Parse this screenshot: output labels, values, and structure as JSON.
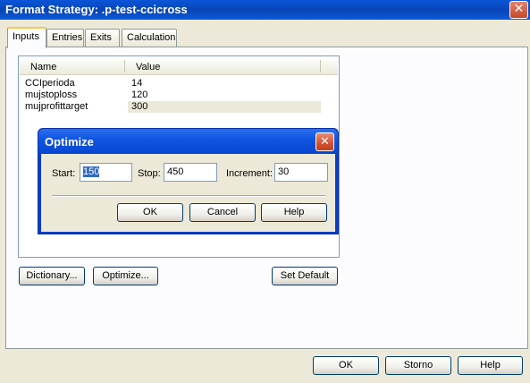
{
  "window": {
    "title": "Format Strategy: .p-test-ccicross"
  },
  "tabs": [
    {
      "label": "Inputs",
      "active": true
    },
    {
      "label": "Entries",
      "active": false
    },
    {
      "label": "Exits",
      "active": false
    },
    {
      "label": "Calculation",
      "active": false
    }
  ],
  "inputs_list": {
    "columns": [
      "Name",
      "Value"
    ],
    "rows": [
      {
        "name": "CCIperioda",
        "value": "14"
      },
      {
        "name": "mujstoploss",
        "value": "120"
      },
      {
        "name": "mujprofittarget",
        "value": "300"
      }
    ]
  },
  "panel_buttons": {
    "dictionary": "Dictionary...",
    "optimize": "Optimize...",
    "set_default": "Set Default"
  },
  "footer_buttons": {
    "ok": "OK",
    "storno": "Storno",
    "help": "Help"
  },
  "optimize_dialog": {
    "title": "Optimize",
    "start_label": "Start:",
    "start_value": "150",
    "stop_label": "Stop:",
    "stop_value": "450",
    "increment_label": "Increment:",
    "increment_value": "30",
    "ok": "OK",
    "cancel": "Cancel",
    "help": "Help"
  },
  "colors": {
    "xp_blue": "#0a3ec4",
    "dialog_face": "#ece9d8",
    "selection": "#316ac5"
  }
}
